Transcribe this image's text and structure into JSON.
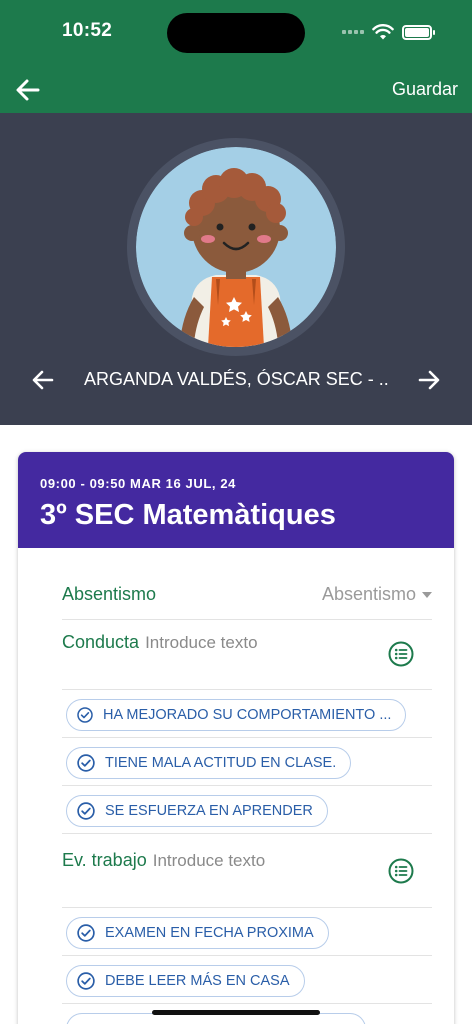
{
  "status_bar": {
    "time": "10:52"
  },
  "toolbar": {
    "save_label": "Guardar"
  },
  "student": {
    "name": "ARGANDA VALDÉS, ÓSCAR SEC - ..."
  },
  "session": {
    "time": "09:00 - 09:50 MAR 16 JUL, 24",
    "title": "3º SEC Matemàtiques"
  },
  "absentismo": {
    "label": "Absentismo",
    "selected": "Absentismo"
  },
  "conducta": {
    "label": "Conducta",
    "placeholder": "Introduce texto",
    "chips": [
      "HA MEJORADO SU COMPORTAMIENTO ...",
      "TIENE MALA ACTITUD EN CLASE.",
      "SE ESFUERZA EN APRENDER"
    ]
  },
  "trabajo": {
    "label": "Ev. trabajo",
    "placeholder": "Introduce texto",
    "chips": [
      "EXAMEN EN FECHA PROXIMA",
      "DEBE LEER MÁS EN CASA"
    ]
  },
  "colors": {
    "primary_green": "#1d7a4c",
    "header_purple": "#4429a0",
    "profile_bg": "#3b4050",
    "chip_blue": "#2a5ea8"
  },
  "icons": [
    "back-arrow-icon",
    "wifi-icon",
    "battery-icon",
    "prev-arrow-icon",
    "next-arrow-icon",
    "list-icon",
    "check-circle-icon"
  ]
}
